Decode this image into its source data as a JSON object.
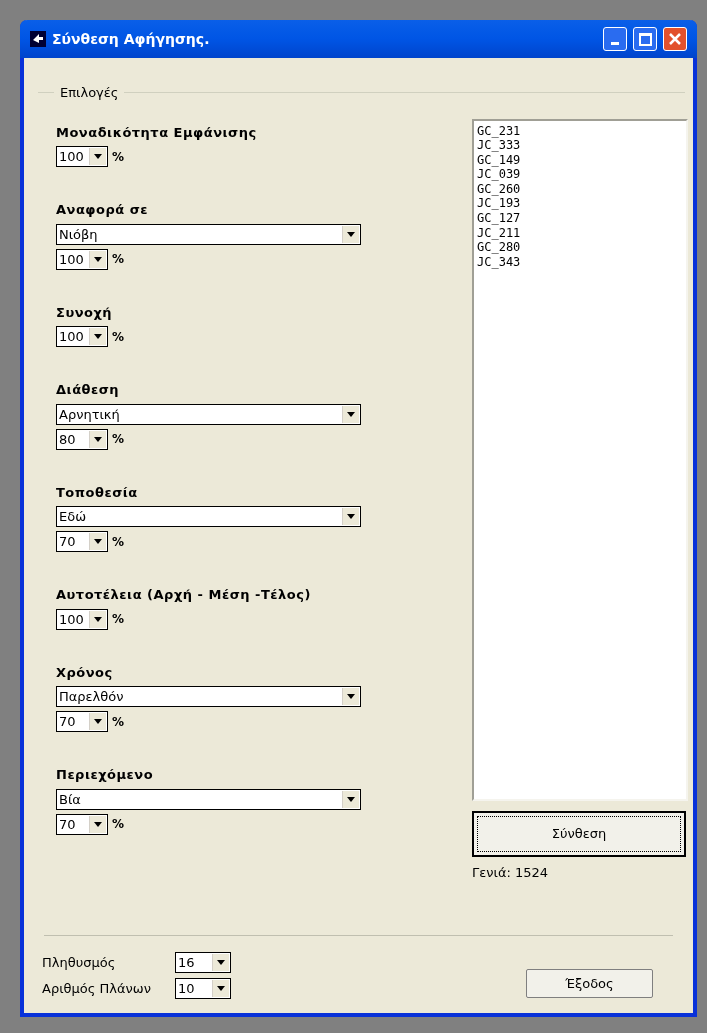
{
  "window": {
    "title": "Σύνθεση Αφήγησης."
  },
  "options": {
    "legend": "Επιλογές",
    "sections": [
      {
        "label": "Μοναδικότητα Εμφάνισης",
        "percent": "100",
        "unit": "%"
      },
      {
        "label": "Αναφορά σε",
        "choice": "Νιόβη",
        "percent": "100",
        "unit": "%"
      },
      {
        "label": "Συνοχή",
        "percent": "100",
        "unit": "%"
      },
      {
        "label": "Διάθεση",
        "choice": "Αρνητική",
        "percent": "80",
        "unit": "%"
      },
      {
        "label": "Τοποθεσία",
        "choice": "Εδώ",
        "percent": "70",
        "unit": "%"
      },
      {
        "label": "Αυτοτέλεια (Αρχή - Μέση -Τέλος)",
        "percent": "100",
        "unit": "%"
      },
      {
        "label": "Χρόνος",
        "choice": "Παρελθόν",
        "percent": "70",
        "unit": "%"
      },
      {
        "label": "Περιεχόμενο",
        "choice": "Βία",
        "percent": "70",
        "unit": "%"
      }
    ],
    "list": [
      "GC_231",
      "JC_333",
      "GC_149",
      "JC_039",
      "GC_260",
      "JC_193",
      "GC_127",
      "JC_211",
      "GC_280",
      "JC_343"
    ],
    "compose_button": "Σύνθεση",
    "generation": "Γενιά: 1524"
  },
  "bottom": {
    "fields": [
      {
        "label": "Πληθυσμός",
        "value": "16"
      },
      {
        "label": "Αριθμός Πλάνων",
        "value": "10"
      }
    ],
    "exit_button": "Έξοδος"
  }
}
